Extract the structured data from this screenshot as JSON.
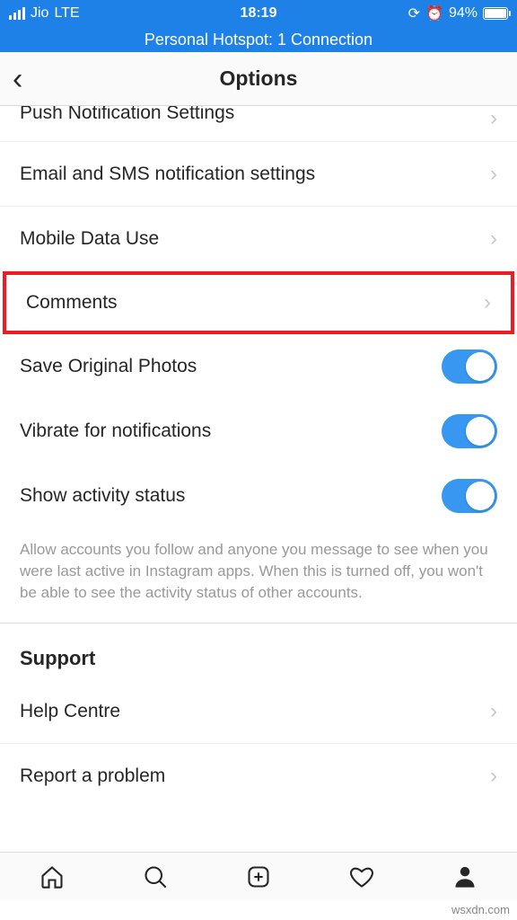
{
  "status_bar": {
    "carrier": "Jio",
    "network": "LTE",
    "time": "18:19",
    "battery_percent": "94%"
  },
  "hotspot": {
    "text": "Personal Hotspot: 1 Connection"
  },
  "header": {
    "title": "Options"
  },
  "items": {
    "push_notifications": "Push Notification Settings",
    "email_sms": "Email and SMS notification settings",
    "mobile_data": "Mobile Data Use",
    "comments": "Comments",
    "save_photos": "Save Original Photos",
    "vibrate": "Vibrate for notifications",
    "activity_status": "Show activity status",
    "help_centre": "Help Centre",
    "report_problem": "Report a problem"
  },
  "description": "Allow accounts you follow and anyone you message to see when you were last active in Instagram apps. When this is turned off, you won't be able to see the activity status of other accounts.",
  "section": {
    "support": "Support"
  },
  "watermark": "wsxdn.com"
}
